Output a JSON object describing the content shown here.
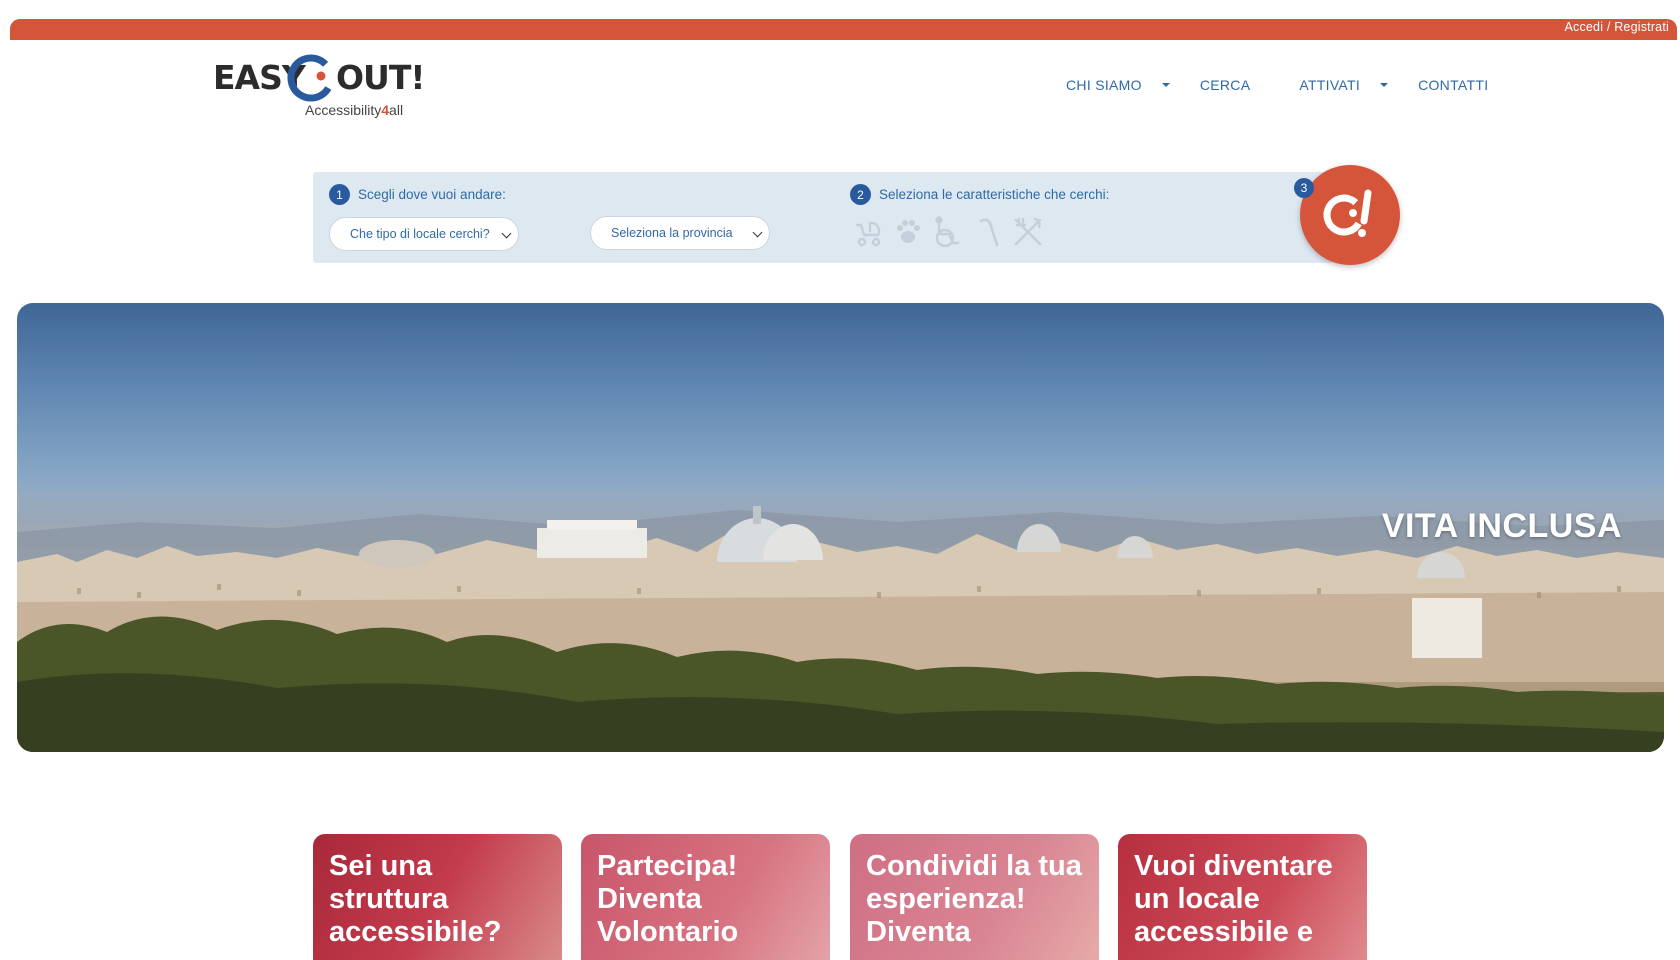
{
  "topbar": {
    "login_label": "Accedi / Registrati"
  },
  "logo": {
    "word_left": "EASY",
    "word_right": "OUT!",
    "tagline_a": "Accessibility",
    "tagline_four": "4",
    "tagline_b": "all"
  },
  "nav": {
    "items": [
      {
        "label": "CHI SIAMO",
        "has_dropdown": true
      },
      {
        "label": "CERCA",
        "has_dropdown": false
      },
      {
        "label": "ATTIVATI",
        "has_dropdown": true
      },
      {
        "label": "CONTATTI",
        "has_dropdown": false
      }
    ]
  },
  "search": {
    "step1": {
      "number": "1",
      "label": "Scegli dove vuoi andare:"
    },
    "select_type": "Che tipo di locale cerchi?",
    "select_province": "Seleziona la provincia",
    "step2": {
      "number": "2",
      "label": "Seleziona le caratteristiche che cerchi:"
    },
    "features": [
      "stroller-icon",
      "paw-icon",
      "wheelchair-icon",
      "cane-icon",
      "fork-knife-icon"
    ],
    "step3": {
      "number": "3"
    }
  },
  "hero": {
    "title": "VITA INCLUSA"
  },
  "cards": [
    {
      "title": "Sei una struttura accessibile?"
    },
    {
      "title": "Partecipa! Diventa Volontario"
    },
    {
      "title": "Condividi la tua esperienza! Diventa"
    },
    {
      "title": "Vuoi diventare un locale accessibile e"
    }
  ],
  "colors": {
    "brand_orange": "#d4553a",
    "brand_blue": "#2a5a9e",
    "link_blue": "#2f6aa6",
    "panel_bg": "#dde8f1"
  }
}
